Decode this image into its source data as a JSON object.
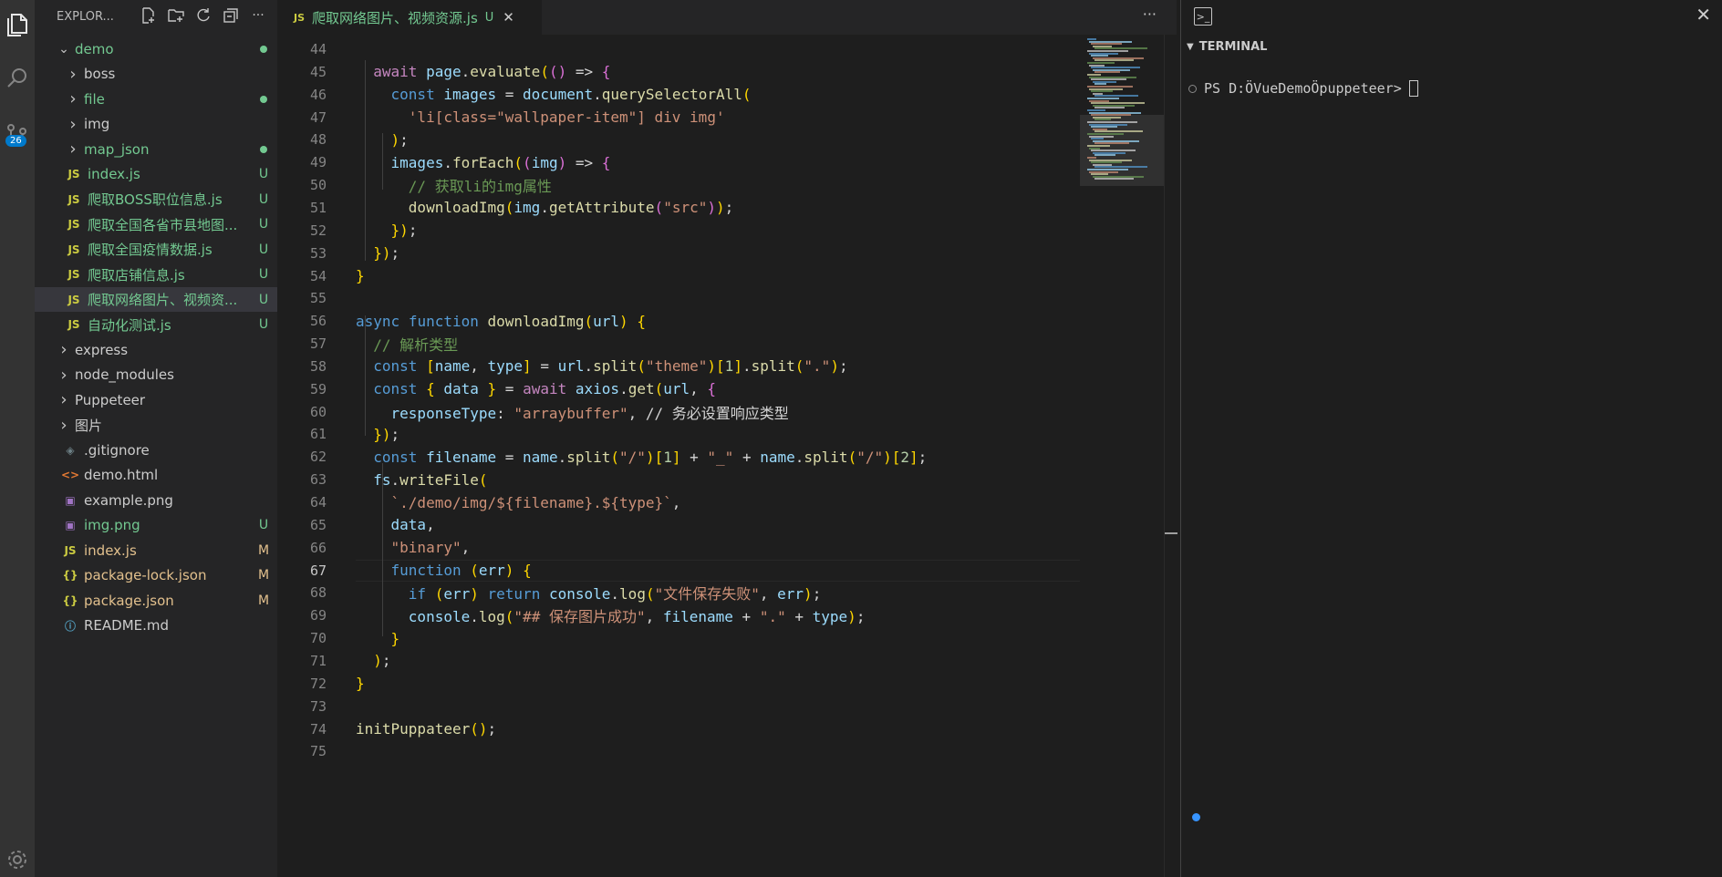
{
  "sidebar": {
    "title": "EXPLOR...",
    "tree": [
      {
        "label": "demo",
        "status": "dot",
        "type": "folder",
        "open": true
      },
      {
        "label": "boss",
        "status": "",
        "type": "folder"
      },
      {
        "label": "file",
        "status": "dot",
        "type": "folder"
      },
      {
        "label": "img",
        "status": "",
        "type": "folder"
      },
      {
        "label": "map_json",
        "status": "dot",
        "type": "folder"
      },
      {
        "label": "index.js",
        "status": "U",
        "type": "js"
      },
      {
        "label": "爬取BOSS职位信息.js",
        "status": "U",
        "type": "js"
      },
      {
        "label": "爬取全国各省市县地图...",
        "status": "U",
        "type": "js"
      },
      {
        "label": "爬取全国疫情数据.js",
        "status": "U",
        "type": "js"
      },
      {
        "label": "爬取店铺信息.js",
        "status": "U",
        "type": "js"
      },
      {
        "label": "爬取网络图片、视频资...",
        "status": "U",
        "type": "js",
        "selected": true
      },
      {
        "label": "自动化测试.js",
        "status": "U",
        "type": "js"
      },
      {
        "label": "express",
        "status": "",
        "type": "folder"
      },
      {
        "label": "node_modules",
        "status": "",
        "type": "folder",
        "dim": true
      },
      {
        "label": "Puppeteer",
        "status": "",
        "type": "folder"
      },
      {
        "label": "图片",
        "status": "",
        "type": "folder"
      },
      {
        "label": ".gitignore",
        "status": "",
        "type": "git"
      },
      {
        "label": "demo.html",
        "status": "",
        "type": "html"
      },
      {
        "label": "example.png",
        "status": "",
        "type": "img"
      },
      {
        "label": "img.png",
        "status": "U",
        "type": "img"
      },
      {
        "label": "index.js",
        "status": "M",
        "type": "js"
      },
      {
        "label": "package-lock.json",
        "status": "M",
        "type": "json"
      },
      {
        "label": "package.json",
        "status": "M",
        "type": "json"
      },
      {
        "label": "README.md",
        "status": "",
        "type": "info"
      }
    ]
  },
  "activity": {
    "badge": "26"
  },
  "tab": {
    "label": "爬取网络图片、视频资源.js",
    "status": "U",
    "close": "✕",
    "icon": "JS"
  },
  "editor_more": "···",
  "code": [
    {
      "n": "44",
      "t": ""
    },
    {
      "n": "45",
      "t": "  await page.evaluate(() => {"
    },
    {
      "n": "46",
      "t": "    const images = document.querySelectorAll("
    },
    {
      "n": "47",
      "t": "      'li[class=\"wallpaper-item\"] div img'"
    },
    {
      "n": "48",
      "t": "    );"
    },
    {
      "n": "49",
      "t": "    images.forEach((img) => {"
    },
    {
      "n": "50",
      "t": "      // 获取li的img属性"
    },
    {
      "n": "51",
      "t": "      downloadImg(img.getAttribute(\"src\"));"
    },
    {
      "n": "52",
      "t": "    });"
    },
    {
      "n": "53",
      "t": "  });"
    },
    {
      "n": "54",
      "t": "}"
    },
    {
      "n": "55",
      "t": ""
    },
    {
      "n": "56",
      "t": "async function downloadImg(url) {"
    },
    {
      "n": "57",
      "t": "  // 解析类型"
    },
    {
      "n": "58",
      "t": "  const [name, type] = url.split(\"theme\")[1].split(\".\");"
    },
    {
      "n": "59",
      "t": "  const { data } = await axios.get(url, {"
    },
    {
      "n": "60",
      "t": "    responseType: \"arraybuffer\", // 务必设置响应类型"
    },
    {
      "n": "61",
      "t": "  });"
    },
    {
      "n": "62",
      "t": "  const filename = name.split(\"/\")[1] + \"_\" + name.split(\"/\")[2];"
    },
    {
      "n": "63",
      "t": "  fs.writeFile("
    },
    {
      "n": "64",
      "t": "    `./demo/img/${filename}.${type}`,"
    },
    {
      "n": "65",
      "t": "    data,"
    },
    {
      "n": "66",
      "t": "    \"binary\","
    },
    {
      "n": "67",
      "t": "    function (err) {"
    },
    {
      "n": "68",
      "t": "      if (err) return console.log(\"文件保存失败\", err);"
    },
    {
      "n": "69",
      "t": "      console.log(\"## 保存图片成功\", filename + \".\" + type);"
    },
    {
      "n": "70",
      "t": "    }"
    },
    {
      "n": "71",
      "t": "  );"
    },
    {
      "n": "72",
      "t": "}"
    },
    {
      "n": "73",
      "t": ""
    },
    {
      "n": "74",
      "t": "initPuppateer();"
    },
    {
      "n": "75",
      "t": ""
    }
  ],
  "current_line": "67",
  "terminal": {
    "title": "TERMINAL",
    "prompt": "PS D:ÖVueDemoÖpuppeteer>",
    "close": "✕"
  },
  "colors": {
    "accent": "#007acc",
    "untracked": "#73c991",
    "modified": "#e2c08d"
  }
}
